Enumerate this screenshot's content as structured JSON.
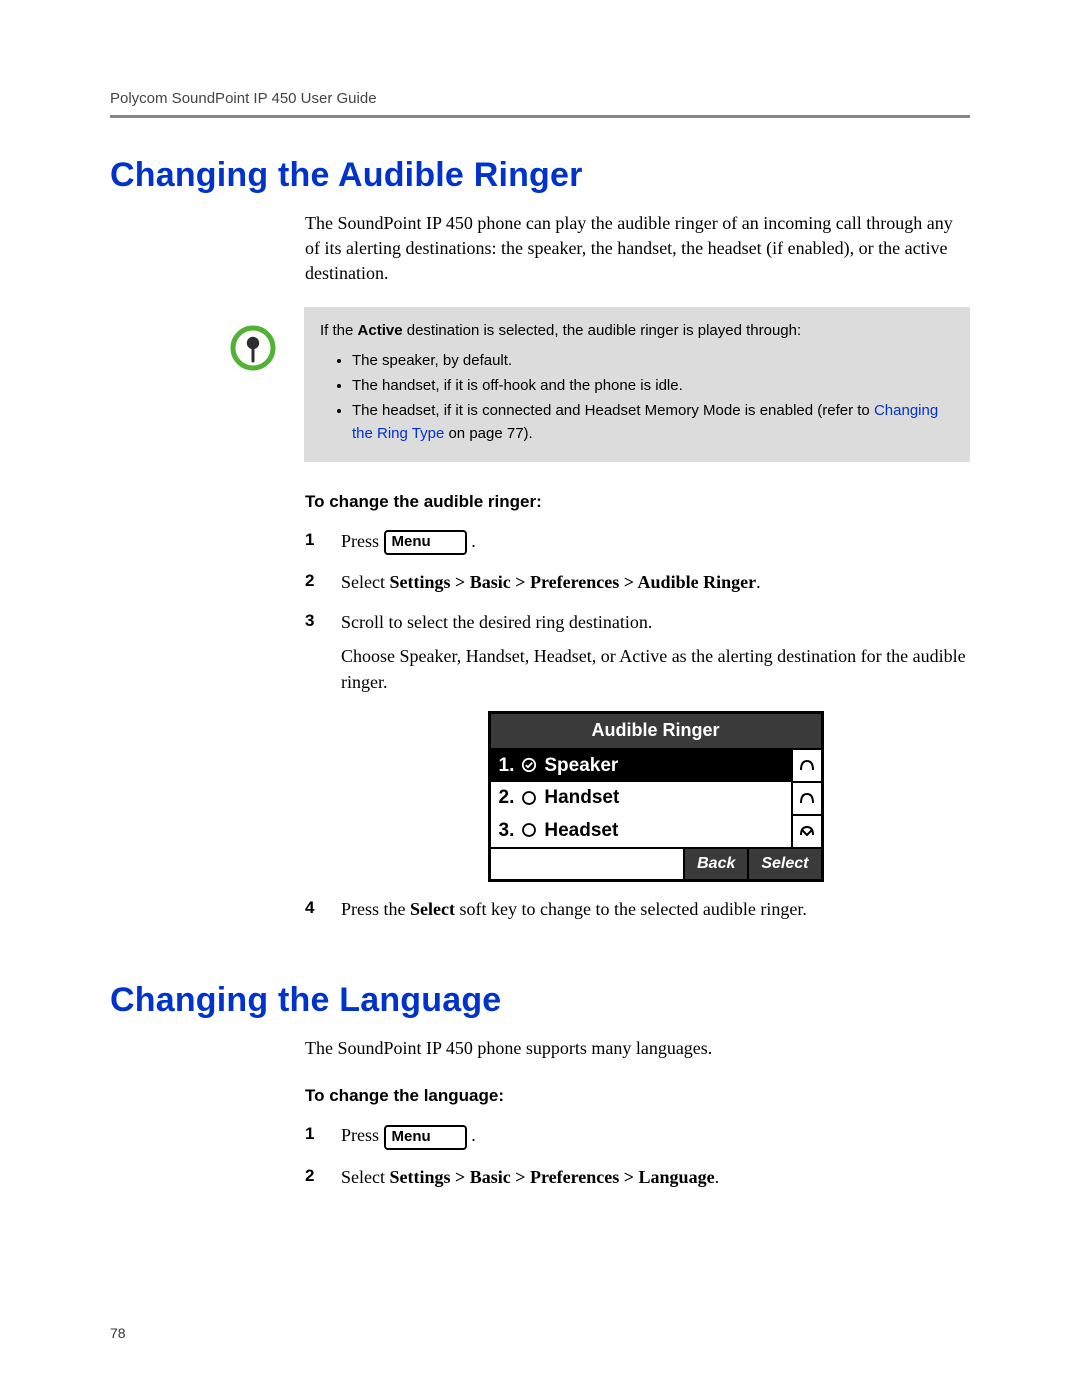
{
  "header": {
    "running": "Polycom SoundPoint IP 450 User Guide"
  },
  "footer": {
    "page": "78"
  },
  "menu_button_label": "Menu",
  "section1": {
    "title": "Changing the Audible Ringer",
    "intro": "The SoundPoint IP 450 phone can play the audible ringer of an incoming call through any of its alerting destinations: the speaker, the handset, the headset (if enabled), or the active destination.",
    "note": {
      "lead_pre": "If the ",
      "lead_bold": "Active",
      "lead_post": " destination is selected, the audible ringer is played through:",
      "bullets": {
        "b1": "The speaker, by default.",
        "b2": "The handset, if it is off-hook and the phone is idle.",
        "b3_pre": "The headset, if it is connected and Headset Memory Mode is enabled (refer to ",
        "b3_link": "Changing the Ring Type",
        "b3_post": " on page 77)."
      }
    },
    "subhead": "To change the audible ringer:",
    "steps": {
      "s1_pre": "Press  ",
      "s1_post": " .",
      "s2_pre": "Select ",
      "s2_bold": "Settings > Basic > Preferences > Audible Ringer",
      "s2_post": ".",
      "s3": "Scroll to select the desired ring destination.",
      "s3_cont": "Choose Speaker, Handset, Headset, or Active as the alerting destination for the audible ringer.",
      "s4_pre": "Press the ",
      "s4_bold": "Select",
      "s4_post": " soft key to change to the selected audible ringer."
    },
    "lcd": {
      "title": "Audible Ringer",
      "row1_num": "1.",
      "row1_label": "Speaker",
      "row2_num": "2.",
      "row2_label": "Handset",
      "row3_num": "3.",
      "row3_label": "Headset",
      "soft_back": "Back",
      "soft_select": "Select"
    }
  },
  "section2": {
    "title": "Changing the Language",
    "intro": "The SoundPoint IP 450 phone supports many languages.",
    "subhead": "To change the language:",
    "steps": {
      "s1_pre": "Press  ",
      "s1_post": " .",
      "s2_pre": "Select ",
      "s2_bold": "Settings > Basic > Preferences > Language",
      "s2_post": "."
    }
  }
}
